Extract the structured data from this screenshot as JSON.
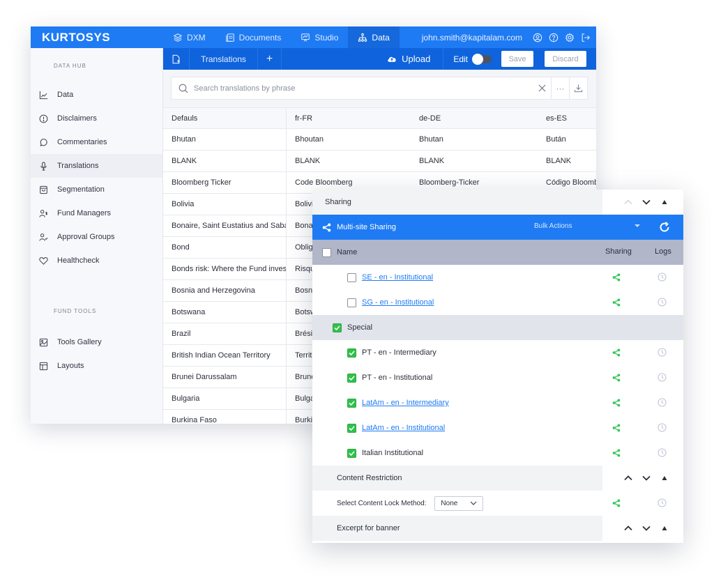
{
  "app": {
    "logo": "KURTOSYS",
    "nav": [
      {
        "label": "DXM",
        "icon": "layers-icon"
      },
      {
        "label": "Documents",
        "icon": "documents-icon"
      },
      {
        "label": "Studio",
        "icon": "presentation-icon"
      },
      {
        "label": "Data",
        "icon": "hierarchy-icon",
        "active": true
      }
    ],
    "user_email": "john.smith@kapitalam.com",
    "user_icons": [
      "user-icon",
      "help-icon",
      "gear-icon",
      "logout-icon"
    ]
  },
  "subbar": {
    "tabs": [
      {
        "label": "Translations"
      }
    ],
    "add_label": "+",
    "upload_label": "Upload",
    "edit_label": "Edit",
    "edit_enabled": false,
    "save_label": "Save",
    "discard_label": "Discard"
  },
  "sidebar": {
    "section1": "DATA HUB",
    "items1": [
      {
        "label": "Data",
        "icon": "chart-line-icon"
      },
      {
        "label": "Disclaimers",
        "icon": "alert-circle-icon"
      },
      {
        "label": "Commentaries",
        "icon": "speech-bubble-icon"
      },
      {
        "label": "Translations",
        "icon": "microphone-icon",
        "active": true
      },
      {
        "label": "Segmentation",
        "icon": "shopping-bag-icon"
      },
      {
        "label": "Fund Managers",
        "icon": "user-dollar-icon"
      },
      {
        "label": "Approval Groups",
        "icon": "user-check-icon"
      },
      {
        "label": "Healthcheck",
        "icon": "heart-icon"
      }
    ],
    "section2": "FUND TOOLS",
    "items2": [
      {
        "label": "Tools Gallery",
        "icon": "image-icon"
      },
      {
        "label": "Layouts",
        "icon": "layout-icon"
      }
    ]
  },
  "search": {
    "placeholder": "Search translations by phrase",
    "value": ""
  },
  "table": {
    "columns": [
      "Defauls",
      "fr-FR",
      "de-DE",
      "es-ES"
    ],
    "rows": [
      [
        "Bhutan",
        "Bhoutan",
        "Bhutan",
        "Bután"
      ],
      [
        "BLANK",
        "BLANK",
        "BLANK",
        "BLANK"
      ],
      [
        "Bloomberg Ticker",
        "Code Bloomberg",
        "Bloomberg-Ticker",
        "Código Bloomberg"
      ],
      [
        "Bolivia",
        "Bolivie",
        "",
        ""
      ],
      [
        "Bonaire, Saint Eustatius and Saba",
        "Bonaire",
        "",
        ""
      ],
      [
        "Bond",
        "Obligation",
        "",
        ""
      ],
      [
        "Bonds risk: Where the Fund invests",
        "Risque",
        "",
        ""
      ],
      [
        "Bosnia and Herzegovina",
        "Bosnie",
        "",
        ""
      ],
      [
        "Botswana",
        "Botswana",
        "",
        ""
      ],
      [
        "Brazil",
        "Brésil",
        "",
        ""
      ],
      [
        "British Indian Ocean Territory",
        "Territoire",
        "",
        ""
      ],
      [
        "Brunei Darussalam",
        "Brunéi",
        "",
        ""
      ],
      [
        "Bulgaria",
        "Bulgarie",
        "",
        ""
      ],
      [
        "Burkina Faso",
        "Burkina",
        "",
        ""
      ]
    ]
  },
  "panel": {
    "sharing_title": "Sharing",
    "multisite_title": "Multi-site Sharing",
    "bulk_actions": "Bulk Actions",
    "head": {
      "name": "Name",
      "sharing": "Sharing",
      "logs": "Logs"
    },
    "items": [
      {
        "label": "SE - en - Institutional",
        "link": true,
        "checked": false,
        "group": false
      },
      {
        "label": "SG - en - Institutional",
        "link": true,
        "checked": false,
        "group": false
      },
      {
        "label": "Special",
        "link": false,
        "checked": true,
        "group": true
      },
      {
        "label": "PT - en - Intermediary",
        "link": false,
        "checked": true,
        "group": false
      },
      {
        "label": "PT - en - Institutional",
        "link": false,
        "checked": true,
        "group": false
      },
      {
        "label": "LatAm - en - Intermediary",
        "link": true,
        "checked": true,
        "group": false
      },
      {
        "label": "LatAm - en - Institutional",
        "link": true,
        "checked": true,
        "group": false
      },
      {
        "label": "Italian Institutional",
        "link": false,
        "checked": true,
        "group": false
      }
    ],
    "content_restriction": "Content Restriction",
    "lock_label": "Select Content Lock Method:",
    "lock_value": "None",
    "excerpt_title": "Excerpt for banner"
  },
  "colors": {
    "brand_blue": "#1e7bf3",
    "sub_blue": "#0f63dc",
    "check_green": "#2ec24a",
    "share_green": "#34c759",
    "header_gray": "#b1b6c9"
  }
}
